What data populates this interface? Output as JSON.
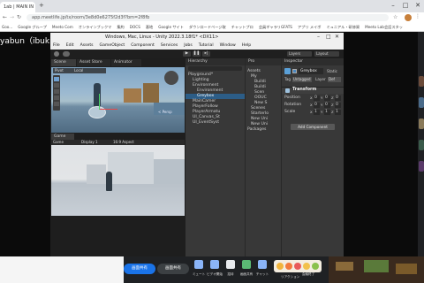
{
  "browser": {
    "active_tab": "1ab | MAIN IN",
    "url": "app.meetlife.jp/tx/room/3e8d0e6275f2d3f?bm=2f8fb",
    "bookmarks": [
      "Goo...",
      "Google グループ",
      "Meeto Com",
      "オンラインブックマ",
      "集約",
      "DOCS",
      "基地",
      "Google サイト",
      "ダウンロードページ取",
      "チャットプロ",
      "会員ギャラリGFATS",
      "アプリ メイボ",
      "ミュニアル・研修資",
      "Meeto Lab会話スタッ"
    ]
  },
  "share": {
    "title": "yabun（ibuki（実））のスクリーン"
  },
  "unity": {
    "window_title": "Windows, Mac, Linux - Unity 2022.3.18f1* <DX11>",
    "menu": [
      "File",
      "Edit",
      "Assets",
      "GameObject",
      "Component",
      "Services",
      "Jobs",
      "Tutorial",
      "Window",
      "Help"
    ],
    "toolbar": {
      "layers": "Layers",
      "layout": "Layout"
    },
    "scene_tab": "Scene",
    "asset_store_tab": "Asset Store",
    "animator_tab": "Animator",
    "scene_tools": {
      "pivot": "Pivot",
      "local": "Local"
    },
    "scene_gizmo_label": "< Persp",
    "game_tab": "Game",
    "game_toolbar": {
      "mode": "Game",
      "display": "Display 1",
      "aspect": "16:9 Aspect"
    },
    "hierarchy_tab": "Hierarchy",
    "hierarchy": [
      {
        "label": "Playground*",
        "depth": 0,
        "selected": false
      },
      {
        "label": "Lighting",
        "depth": 1,
        "selected": false
      },
      {
        "label": "Environment",
        "depth": 1,
        "selected": false
      },
      {
        "label": "Environment",
        "depth": 2,
        "selected": false
      },
      {
        "label": "Greybox",
        "depth": 2,
        "selected": true
      },
      {
        "label": "MainCamer",
        "depth": 1,
        "selected": false
      },
      {
        "label": "PlayerFollow",
        "depth": 1,
        "selected": false
      },
      {
        "label": "PlayerArmatu",
        "depth": 1,
        "selected": false
      },
      {
        "label": "UI_Canvas_St",
        "depth": 1,
        "selected": false
      },
      {
        "label": "UI_EventSyst",
        "depth": 1,
        "selected": false
      }
    ],
    "project_tab": "Pro",
    "project": [
      {
        "label": "Assets",
        "depth": 0
      },
      {
        "label": "My",
        "depth": 1
      },
      {
        "label": "Buildi",
        "depth": 2
      },
      {
        "label": "Buildi",
        "depth": 2
      },
      {
        "label": "Scen",
        "depth": 2
      },
      {
        "label": "OOUC",
        "depth": 2
      },
      {
        "label": "New S",
        "depth": 2
      },
      {
        "label": "Scenes",
        "depth": 1
      },
      {
        "label": "Starterlo",
        "depth": 1
      },
      {
        "label": "New Uni",
        "depth": 1
      },
      {
        "label": "New Uni",
        "depth": 1
      },
      {
        "label": "Packages",
        "depth": 0
      }
    ],
    "inspector": {
      "tab": "Inspector",
      "object_name": "Greybox",
      "static_label": "Static",
      "tag_label": "Tag",
      "tag_value": "Untagged",
      "layer_label": "Layer",
      "layer_value": "Def",
      "transform_label": "Transform",
      "fields": [
        {
          "name": "Position",
          "x": "0",
          "y": "0",
          "z": "0"
        },
        {
          "name": "Rotation",
          "x": "0",
          "y": "0",
          "z": "0"
        },
        {
          "name": "Scale",
          "x": "1",
          "y": "1",
          "z": "1"
        }
      ],
      "axis_labels": [
        "X",
        "Y",
        "Z"
      ],
      "add_component": "Add Component"
    }
  },
  "taskbar": {
    "share_pill": "画面共有",
    "stop_pill": "画面共有",
    "items": [
      "ミュート",
      "ビデオ開始",
      "招待",
      "画面共有",
      "チャット",
      "その他",
      "会議終了"
    ],
    "reactions_label": "リアクション"
  },
  "colors": {
    "unity_bg": "#282828",
    "panel": "#383838",
    "selection": "#2c5d87",
    "share_pill": "#1a73e8"
  }
}
